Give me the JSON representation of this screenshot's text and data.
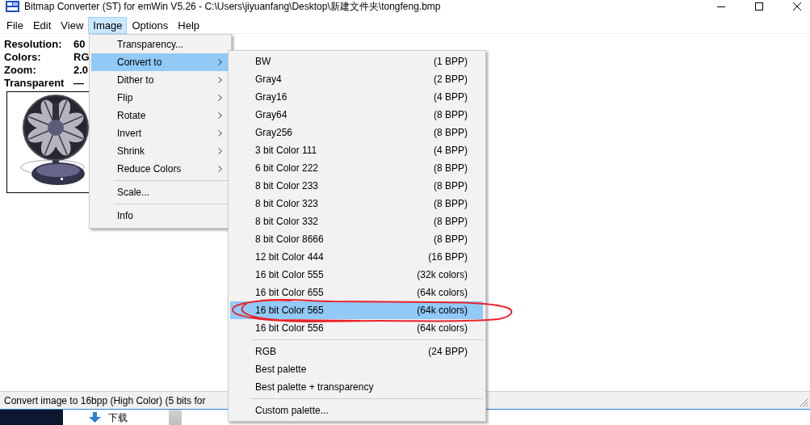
{
  "window": {
    "title": "Bitmap Converter (ST) for emWin V5.26 - C:\\Users\\jiyuanfang\\Desktop\\新建文件夹\\tongfeng.bmp"
  },
  "menu_bar": [
    {
      "label": "File",
      "selected": false
    },
    {
      "label": "Edit",
      "selected": false
    },
    {
      "label": "View",
      "selected": false
    },
    {
      "label": "Image",
      "selected": true
    },
    {
      "label": "Options",
      "selected": false
    },
    {
      "label": "Help",
      "selected": false
    }
  ],
  "info": [
    {
      "label": "Resolution:",
      "value": "60"
    },
    {
      "label": "Colors:",
      "value": "RG"
    },
    {
      "label": "Zoom:",
      "value": "2.0"
    },
    {
      "label": "Transparent",
      "value": "—"
    }
  ],
  "image_menu": {
    "items": [
      {
        "kind": "item",
        "label": "Transparency...",
        "submenu": false,
        "selected": false
      },
      {
        "kind": "item",
        "label": "Convert to",
        "submenu": true,
        "selected": true
      },
      {
        "kind": "item",
        "label": "Dither to",
        "submenu": true,
        "selected": false
      },
      {
        "kind": "item",
        "label": "Flip",
        "submenu": true,
        "selected": false
      },
      {
        "kind": "item",
        "label": "Rotate",
        "submenu": true,
        "selected": false
      },
      {
        "kind": "item",
        "label": "Invert",
        "submenu": true,
        "selected": false
      },
      {
        "kind": "item",
        "label": "Shrink",
        "submenu": true,
        "selected": false
      },
      {
        "kind": "item",
        "label": "Reduce Colors",
        "submenu": true,
        "selected": false
      },
      {
        "kind": "separator"
      },
      {
        "kind": "item",
        "label": "Scale...",
        "submenu": false,
        "selected": false
      },
      {
        "kind": "separator"
      },
      {
        "kind": "item",
        "label": "Info",
        "submenu": false,
        "selected": false
      }
    ]
  },
  "convert_submenu": {
    "items": [
      {
        "kind": "item",
        "label": "BW",
        "detail": "(1 BPP)",
        "selected": false,
        "circled": false
      },
      {
        "kind": "item",
        "label": "Gray4",
        "detail": "(2 BPP)",
        "selected": false,
        "circled": false
      },
      {
        "kind": "item",
        "label": "Gray16",
        "detail": "(4 BPP)",
        "selected": false,
        "circled": false
      },
      {
        "kind": "item",
        "label": "Gray64",
        "detail": "(8 BPP)",
        "selected": false,
        "circled": false
      },
      {
        "kind": "item",
        "label": "Gray256",
        "detail": "(8 BPP)",
        "selected": false,
        "circled": false
      },
      {
        "kind": "item",
        "label": "3 bit Color 111",
        "detail": "(4 BPP)",
        "selected": false,
        "circled": false
      },
      {
        "kind": "item",
        "label": "6 bit Color 222",
        "detail": "(8 BPP)",
        "selected": false,
        "circled": false
      },
      {
        "kind": "item",
        "label": "8 bit Color 233",
        "detail": "(8 BPP)",
        "selected": false,
        "circled": false
      },
      {
        "kind": "item",
        "label": "8 bit Color 323",
        "detail": "(8 BPP)",
        "selected": false,
        "circled": false
      },
      {
        "kind": "item",
        "label": "8 bit Color 332",
        "detail": "(8 BPP)",
        "selected": false,
        "circled": false
      },
      {
        "kind": "item",
        "label": "8 bit Color 8666",
        "detail": "(8 BPP)",
        "selected": false,
        "circled": false
      },
      {
        "kind": "item",
        "label": "12 bit Color 444",
        "detail": "(16 BPP)",
        "selected": false,
        "circled": false
      },
      {
        "kind": "item",
        "label": "16 bit Color 555",
        "detail": "(32k colors)",
        "selected": false,
        "circled": false
      },
      {
        "kind": "item",
        "label": "16 bit Color 655",
        "detail": "(64k colors)",
        "selected": false,
        "circled": false
      },
      {
        "kind": "item",
        "label": "16 bit Color 565",
        "detail": "(64k colors)",
        "selected": true,
        "circled": true
      },
      {
        "kind": "item",
        "label": "16 bit Color 556",
        "detail": "(64k colors)",
        "selected": false,
        "circled": false
      },
      {
        "kind": "separator"
      },
      {
        "kind": "item",
        "label": "RGB",
        "detail": "(24 BPP)",
        "selected": false,
        "circled": false
      },
      {
        "kind": "item",
        "label": "Best palette",
        "selected": false,
        "circled": false
      },
      {
        "kind": "item",
        "label": "Best palette + transparency",
        "selected": false,
        "circled": false
      },
      {
        "kind": "separator"
      },
      {
        "kind": "item",
        "label": "Custom palette...",
        "selected": false,
        "circled": false
      }
    ]
  },
  "status_bar": {
    "text": "Convert image to 16bpp (High Color) (5 bits for"
  },
  "taskbar": {
    "label": "下载"
  }
}
